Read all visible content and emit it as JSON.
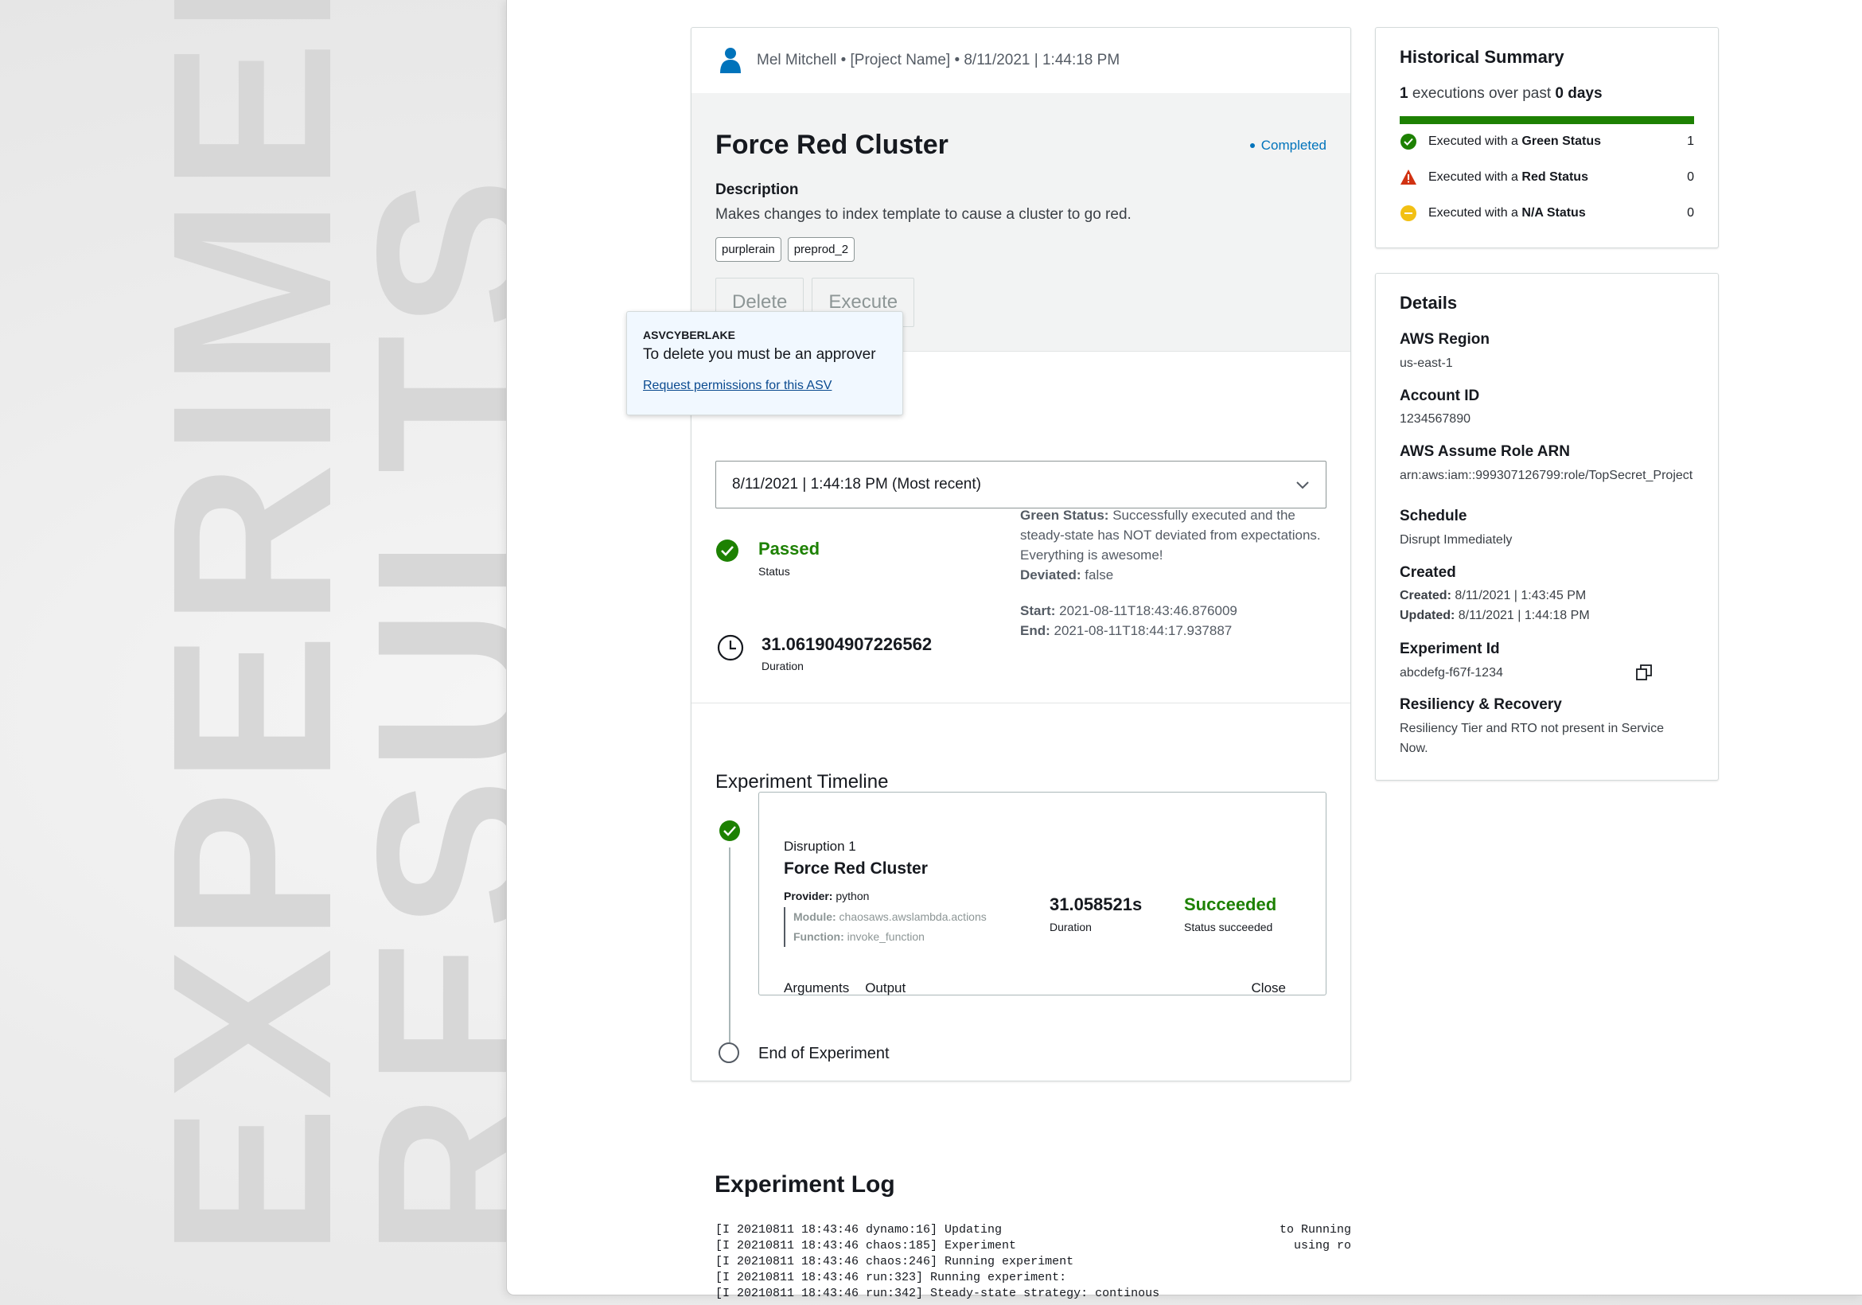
{
  "background": {
    "word1": "EXPERIMENT",
    "word2": "RESULTS"
  },
  "header": {
    "byline": "Mel Mitchell • [Project Name] • 8/11/2021 | 1:44:18 PM"
  },
  "experiment": {
    "title": "Force Red Cluster",
    "status": "Completed",
    "description_label": "Description",
    "description": "Makes changes to index template to cause a cluster to go red.",
    "tags": [
      "purplerain",
      "preprod_2"
    ],
    "buttons": {
      "delete": "Delete",
      "execute": "Execute"
    }
  },
  "popover": {
    "title": "ASVCYBERLAKE",
    "message": "To delete you must be an approver",
    "link": "Request permissions for this ASV"
  },
  "run_select": {
    "value": "8/11/2021 | 1:44:18 PM (Most recent)"
  },
  "result": {
    "status_value": "Passed",
    "status_label": "Status",
    "green_status_label": "Green Status:",
    "green_status_text": "Successfully executed and the steady-state has NOT deviated from expectations. Everything is awesome!",
    "deviated_label": "Deviated:",
    "deviated_value": "false",
    "duration_value": "31.061904907226562",
    "duration_label": "Duration",
    "start_label": "Start:",
    "start_value": "2021-08-11T18:43:46.876009",
    "end_label": "End:",
    "end_value": "2021-08-11T18:44:17.937887"
  },
  "timeline": {
    "title": "Experiment Timeline",
    "disruption": {
      "number": "Disruption 1",
      "name": "Force Red Cluster",
      "provider_label": "Provider:",
      "provider": "python",
      "module_label": "Module:",
      "module": "chaosaws.awslambda.actions",
      "function_label": "Function:",
      "function": "invoke_function",
      "duration_value": "31.058521s",
      "duration_label": "Duration",
      "status_value": "Succeeded",
      "status_label": "Status succeeded",
      "tab_arguments": "Arguments",
      "tab_output": "Output",
      "close": "Close"
    },
    "end_label": "End of Experiment"
  },
  "log": {
    "title": "Experiment Log",
    "lines": [
      "[I 20210811 18:43:46 dynamo:16] Updating",
      "[I 20210811 18:43:46 chaos:185] Experiment",
      "[I 20210811 18:43:46 chaos:246] Running experiment",
      "[I 20210811 18:43:46 run:323] Running experiment:",
      "[I 20210811 18:43:46 run:342] Steady-state strategy: continous"
    ],
    "right_lines": [
      "to Running",
      "using ro"
    ]
  },
  "historical": {
    "title": "Historical Summary",
    "executions_count": "1",
    "executions_text": " executions over past ",
    "days_count": "0 days",
    "rows": [
      {
        "prefix": "Executed with a ",
        "status": "Green Status",
        "count": "1"
      },
      {
        "prefix": "Executed with a ",
        "status": "Red Status",
        "count": "0"
      },
      {
        "prefix": "Executed with a ",
        "status": "N/A Status",
        "count": "0"
      }
    ],
    "colors": {
      "green": "#1d8102",
      "red": "#d13212",
      "yellow": "#f2c014"
    }
  },
  "details": {
    "title": "Details",
    "aws_region_label": "AWS Region",
    "aws_region": "us-east-1",
    "account_id_label": "Account ID",
    "account_id": "1234567890",
    "role_arn_label": "AWS Assume Role ARN",
    "role_arn": "arn:aws:iam::999307126799:role/TopSecret_Project",
    "schedule_label": "Schedule",
    "schedule": "Disrupt Immediately",
    "created_label": "Created",
    "created_sub_label": "Created:",
    "created_value": "8/11/2021 | 1:43:45 PM",
    "updated_sub_label": "Updated:",
    "updated_value": "8/11/2021 | 1:44:18 PM",
    "experiment_id_label": "Experiment Id",
    "experiment_id": "abcdefg-f67f-1234",
    "resiliency_label": "Resiliency & Recovery",
    "resiliency_line1": "Resiliency Tier and RTO not present in Service",
    "resiliency_line2": "Now."
  }
}
